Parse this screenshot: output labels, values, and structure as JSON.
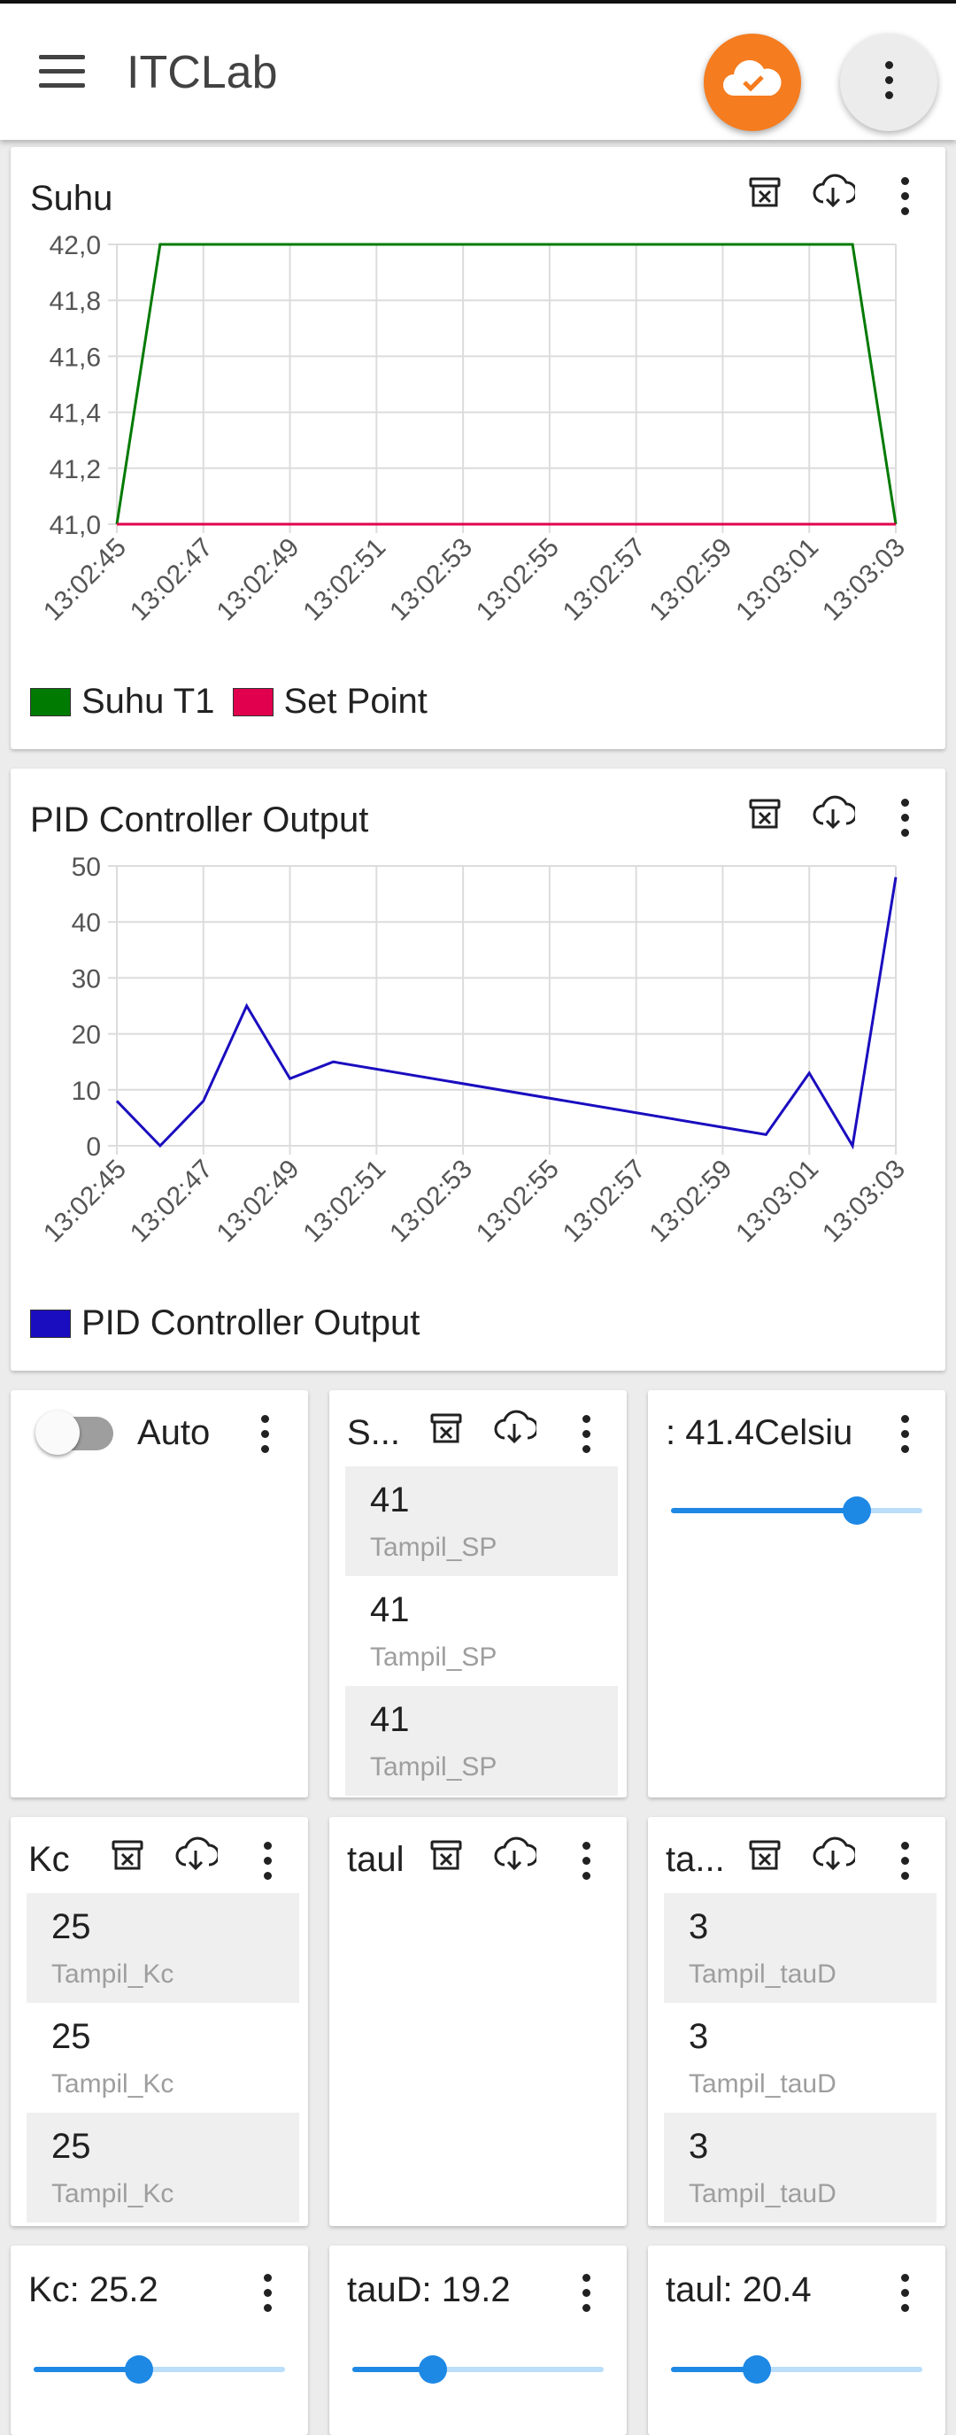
{
  "app": {
    "title": "ITCLab"
  },
  "colors": {
    "accent": "#f57c1f",
    "slider": "#1e88e5",
    "suhu_t1": "#007a00",
    "set_point": "#e0004d",
    "pid": "#1a0dbf"
  },
  "icons": {
    "menu": "menu-icon",
    "cloud": "cloud-done-icon",
    "more": "more-vert-icon",
    "delete": "delete-data-icon",
    "download": "cloud-download-icon"
  },
  "suhu_card": {
    "title": "Suhu",
    "legend": [
      "Suhu T1",
      "Set Point"
    ]
  },
  "pid_card": {
    "title": "PID Controller Output",
    "legend": [
      "PID Controller Output"
    ]
  },
  "auto_card": {
    "label": "Auto",
    "checked": false
  },
  "sp_card": {
    "title": "S...",
    "items": [
      {
        "value": "41",
        "sub": "Tampil_SP"
      },
      {
        "value": "41",
        "sub": "Tampil_SP"
      },
      {
        "value": "41",
        "sub": "Tampil_SP"
      }
    ]
  },
  "setpoint_slider": {
    "title": ": 41.4Celsiu",
    "level": 0.74
  },
  "kc_card": {
    "title": "Kc",
    "items": [
      {
        "value": "25",
        "sub": "Tampil_Kc"
      },
      {
        "value": "25",
        "sub": "Tampil_Kc"
      },
      {
        "value": "25",
        "sub": "Tampil_Kc"
      }
    ]
  },
  "taui_card": {
    "title": "taul",
    "items": []
  },
  "taud_card": {
    "title": "ta...",
    "items": [
      {
        "value": "3",
        "sub": "Tampil_tauD"
      },
      {
        "value": "3",
        "sub": "Tampil_tauD"
      },
      {
        "value": "3",
        "sub": "Tampil_tauD"
      }
    ]
  },
  "kc_slider": {
    "title": "Kc: 25.2",
    "level": 0.42
  },
  "taud_slider": {
    "title": "tauD: 19.2",
    "level": 0.32
  },
  "taui_slider": {
    "title": "taul: 20.4",
    "level": 0.34
  },
  "chart_data": [
    {
      "type": "line",
      "title": "Suhu",
      "x": [
        "13:02:45",
        "13:02:46",
        "13:02:47",
        "13:02:48",
        "13:02:49",
        "13:02:50",
        "13:02:51",
        "13:02:52",
        "13:02:53",
        "13:02:54",
        "13:02:55",
        "13:02:56",
        "13:02:57",
        "13:02:58",
        "13:02:59",
        "13:03:00",
        "13:03:01",
        "13:03:02",
        "13:03:03"
      ],
      "x_ticks": [
        "13:02:45",
        "13:02:47",
        "13:02:49",
        "13:02:51",
        "13:02:53",
        "13:02:55",
        "13:02:57",
        "13:02:59",
        "13:03:01",
        "13:03:03"
      ],
      "y_ticks": [
        "42,0",
        "41,8",
        "41,6",
        "41,4",
        "41,2",
        "41,0"
      ],
      "ylim": [
        41.0,
        42.0
      ],
      "grid": true,
      "legend_position": "bottom-left",
      "series": [
        {
          "name": "Suhu T1",
          "color": "#007a00",
          "values": [
            41.0,
            42.0,
            42.0,
            42.0,
            42.0,
            42.0,
            42.0,
            42.0,
            42.0,
            42.0,
            42.0,
            42.0,
            42.0,
            42.0,
            42.0,
            42.0,
            42.0,
            42.0,
            41.0
          ]
        },
        {
          "name": "Set Point",
          "color": "#e0004d",
          "values": [
            41.0,
            41.0,
            41.0,
            41.0,
            41.0,
            41.0,
            41.0,
            41.0,
            41.0,
            41.0,
            41.0,
            41.0,
            41.0,
            41.0,
            41.0,
            41.0,
            41.0,
            41.0,
            41.0
          ]
        }
      ]
    },
    {
      "type": "line",
      "title": "PID Controller Output",
      "x": [
        "13:02:45",
        "13:02:46",
        "13:02:47",
        "13:02:48",
        "13:02:49",
        "13:02:50",
        "13:03:00",
        "13:03:01",
        "13:03:02",
        "13:03:03"
      ],
      "x_ticks": [
        "13:02:45",
        "13:02:47",
        "13:02:49",
        "13:02:51",
        "13:02:53",
        "13:02:55",
        "13:02:57",
        "13:02:59",
        "13:03:01",
        "13:03:03"
      ],
      "y_ticks": [
        "50",
        "40",
        "30",
        "20",
        "10",
        "0"
      ],
      "ylim": [
        0,
        50
      ],
      "grid": true,
      "legend_position": "bottom-left",
      "series": [
        {
          "name": "PID Controller Output",
          "color": "#1a0dbf",
          "values": [
            8,
            0,
            8,
            25,
            12,
            15,
            2,
            13,
            0,
            48
          ]
        }
      ]
    }
  ]
}
